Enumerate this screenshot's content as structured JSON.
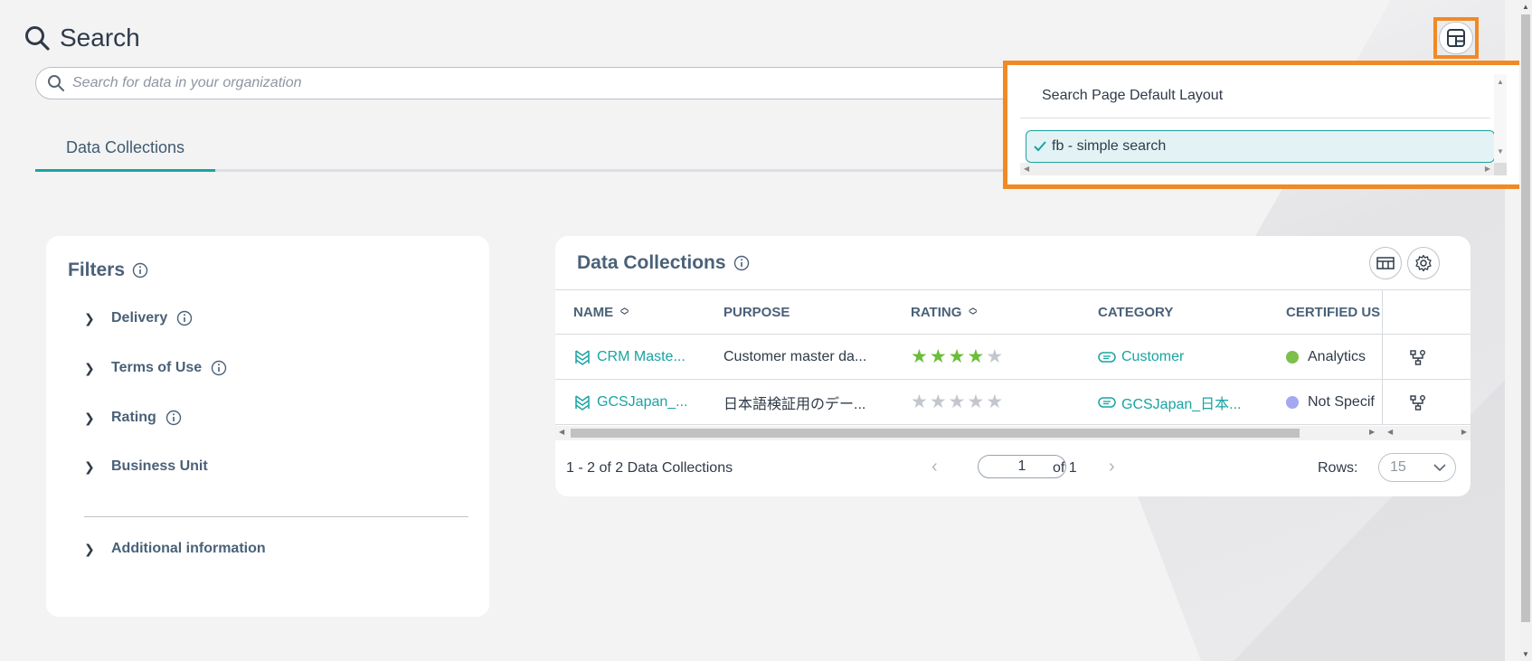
{
  "page": {
    "title": "Search"
  },
  "search": {
    "placeholder": "Search for data in your organization"
  },
  "tabs": [
    {
      "label": "Data Collections",
      "active": true
    }
  ],
  "layout_menu": {
    "header": "Search Page Default Layout",
    "options": [
      {
        "label": "fb - simple search",
        "selected": true
      }
    ]
  },
  "filters": {
    "title": "Filters",
    "items": [
      {
        "label": "Delivery",
        "has_info": true
      },
      {
        "label": "Terms of Use",
        "has_info": true
      },
      {
        "label": "Rating",
        "has_info": true
      },
      {
        "label": "Business Unit",
        "has_info": false
      }
    ],
    "extra": {
      "label": "Additional information"
    }
  },
  "collections": {
    "title": "Data Collections",
    "columns": [
      "NAME",
      "PURPOSE",
      "RATING",
      "CATEGORY",
      "CERTIFIED US"
    ],
    "rows": [
      {
        "name": "CRM Maste...",
        "purpose": "Customer master da...",
        "rating": 4,
        "category": "Customer",
        "certified": "Analytics",
        "certified_color": "#7cc04b"
      },
      {
        "name": "GCSJapan_...",
        "purpose": "日本語検証用のデー...",
        "rating": 0,
        "category": "GCSJapan_日本...",
        "certified": "Not Specif",
        "certified_color": "#a3a8f0"
      }
    ],
    "pager": {
      "summary": "1 - 2 of 2 Data Collections",
      "page": "1",
      "of": "of 1",
      "rows_label": "Rows:",
      "rows_value": "15"
    }
  },
  "colors": {
    "accent": "#1aa3a3",
    "highlight": "#f08a24",
    "star_on": "#6bbd3a",
    "star_off": "#c3c7cd"
  }
}
